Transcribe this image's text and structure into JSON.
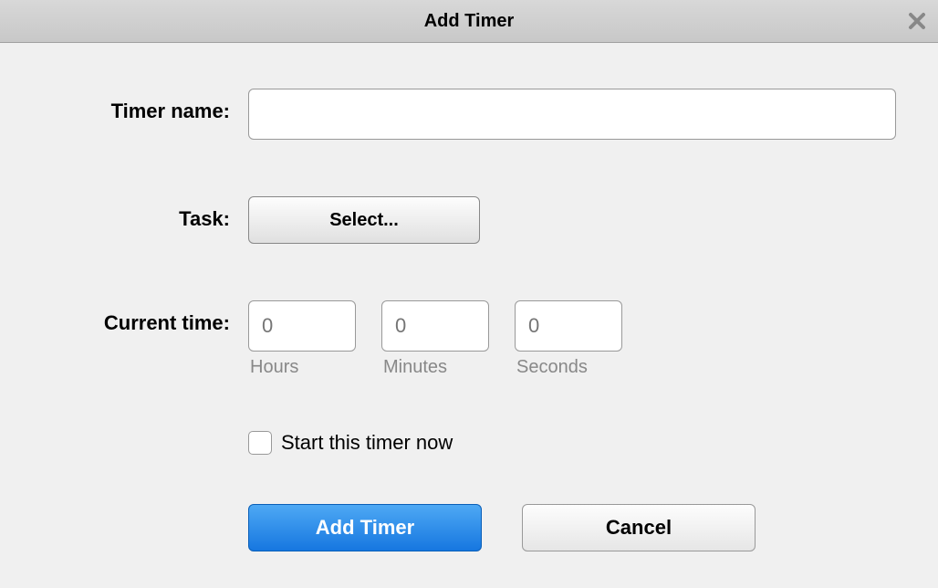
{
  "dialog": {
    "title": "Add Timer",
    "fields": {
      "timer_name": {
        "label": "Timer name:",
        "value": ""
      },
      "task": {
        "label": "Task:",
        "button_label": "Select..."
      },
      "current_time": {
        "label": "Current time:",
        "hours": {
          "placeholder": "0",
          "label": "Hours"
        },
        "minutes": {
          "placeholder": "0",
          "label": "Minutes"
        },
        "seconds": {
          "placeholder": "0",
          "label": "Seconds"
        }
      },
      "start_now": {
        "label": "Start this timer now",
        "checked": false
      }
    },
    "actions": {
      "primary": "Add Timer",
      "secondary": "Cancel"
    }
  }
}
